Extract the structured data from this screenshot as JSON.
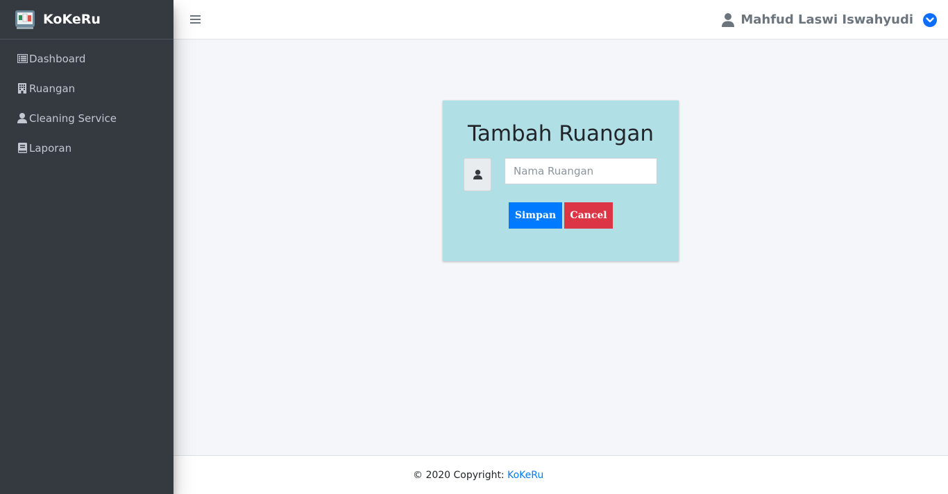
{
  "brand": {
    "name": "KoKeRu"
  },
  "sidebar": {
    "items": [
      {
        "label": "Dashboard",
        "icon": "list-icon"
      },
      {
        "label": "Ruangan",
        "icon": "building-icon"
      },
      {
        "label": "Cleaning Service",
        "icon": "user-icon"
      },
      {
        "label": "Laporan",
        "icon": "book-icon"
      }
    ]
  },
  "topbar": {
    "user_name": "Mahfud Laswi Iswahyudi"
  },
  "form": {
    "title": "Tambah Ruangan",
    "input_placeholder": "Nama Ruangan",
    "input_value": "",
    "save_label": "Simpan",
    "cancel_label": "Cancel"
  },
  "footer": {
    "copyright": "© 2020 Copyright: ",
    "link_label": "KoKeRu"
  },
  "colors": {
    "sidebar_bg": "#343a40",
    "card_bg": "#b0dfe5",
    "primary": "#007bff",
    "danger": "#dc3545"
  }
}
